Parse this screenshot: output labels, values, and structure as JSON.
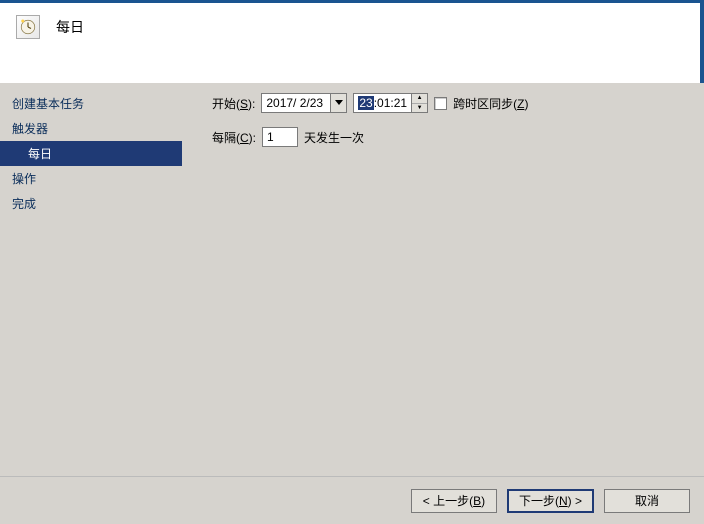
{
  "header": {
    "title": "每日"
  },
  "sidebar": {
    "items": [
      {
        "label": "创建基本任务",
        "selected": false,
        "child": false
      },
      {
        "label": "触发器",
        "selected": false,
        "child": false
      },
      {
        "label": "每日",
        "selected": true,
        "child": true
      },
      {
        "label": "操作",
        "selected": false,
        "child": false
      },
      {
        "label": "完成",
        "selected": false,
        "child": false
      }
    ]
  },
  "form": {
    "start_label_pre": "开始(",
    "start_label_key": "S",
    "start_label_post": "):",
    "date_value": "2017/ 2/23",
    "time_hour_sel": "23",
    "time_rest": ":01:21",
    "tz_label_pre": "跨时区同步(",
    "tz_label_key": "Z",
    "tz_label_post": ")",
    "tz_checked": false,
    "interval_label_pre": "每隔(",
    "interval_label_key": "C",
    "interval_label_post": "):",
    "interval_value": "1",
    "interval_suffix": "天发生一次"
  },
  "footer": {
    "back_pre": "< 上一步(",
    "back_key": "B",
    "back_post": ")",
    "next_pre": "下一步(",
    "next_key": "N",
    "next_post": ") >",
    "cancel": "取消"
  }
}
